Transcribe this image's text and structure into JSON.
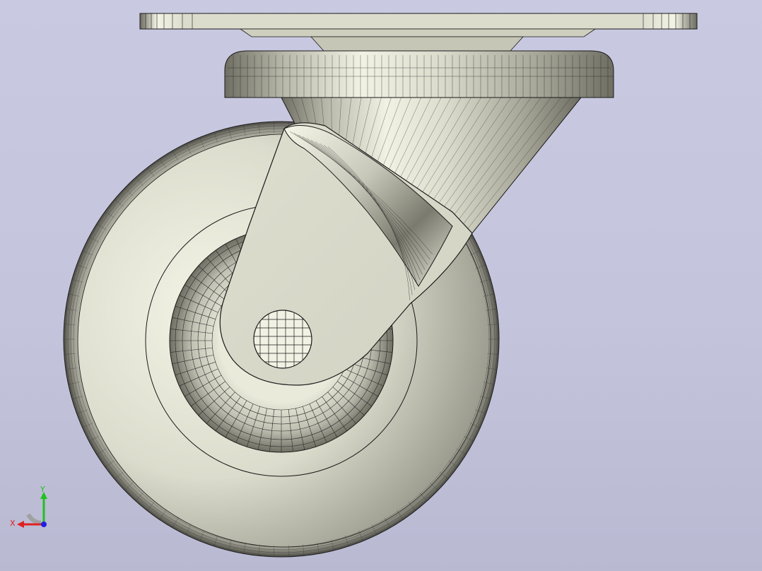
{
  "viewport": {
    "model": "caster-wheel",
    "colors": {
      "background_top": "#c9c9e1",
      "background_bottom": "#b9b9d2",
      "part_fill": "#dcdccd",
      "part_light": "#f4f4e6",
      "part_dark": "#6e6e63",
      "edges": "#1a1a1a"
    }
  },
  "triad": {
    "x_label": "X",
    "y_label": "Y",
    "x_color": "#e02020",
    "y_color": "#20c020",
    "z_color": "#2020e0"
  }
}
